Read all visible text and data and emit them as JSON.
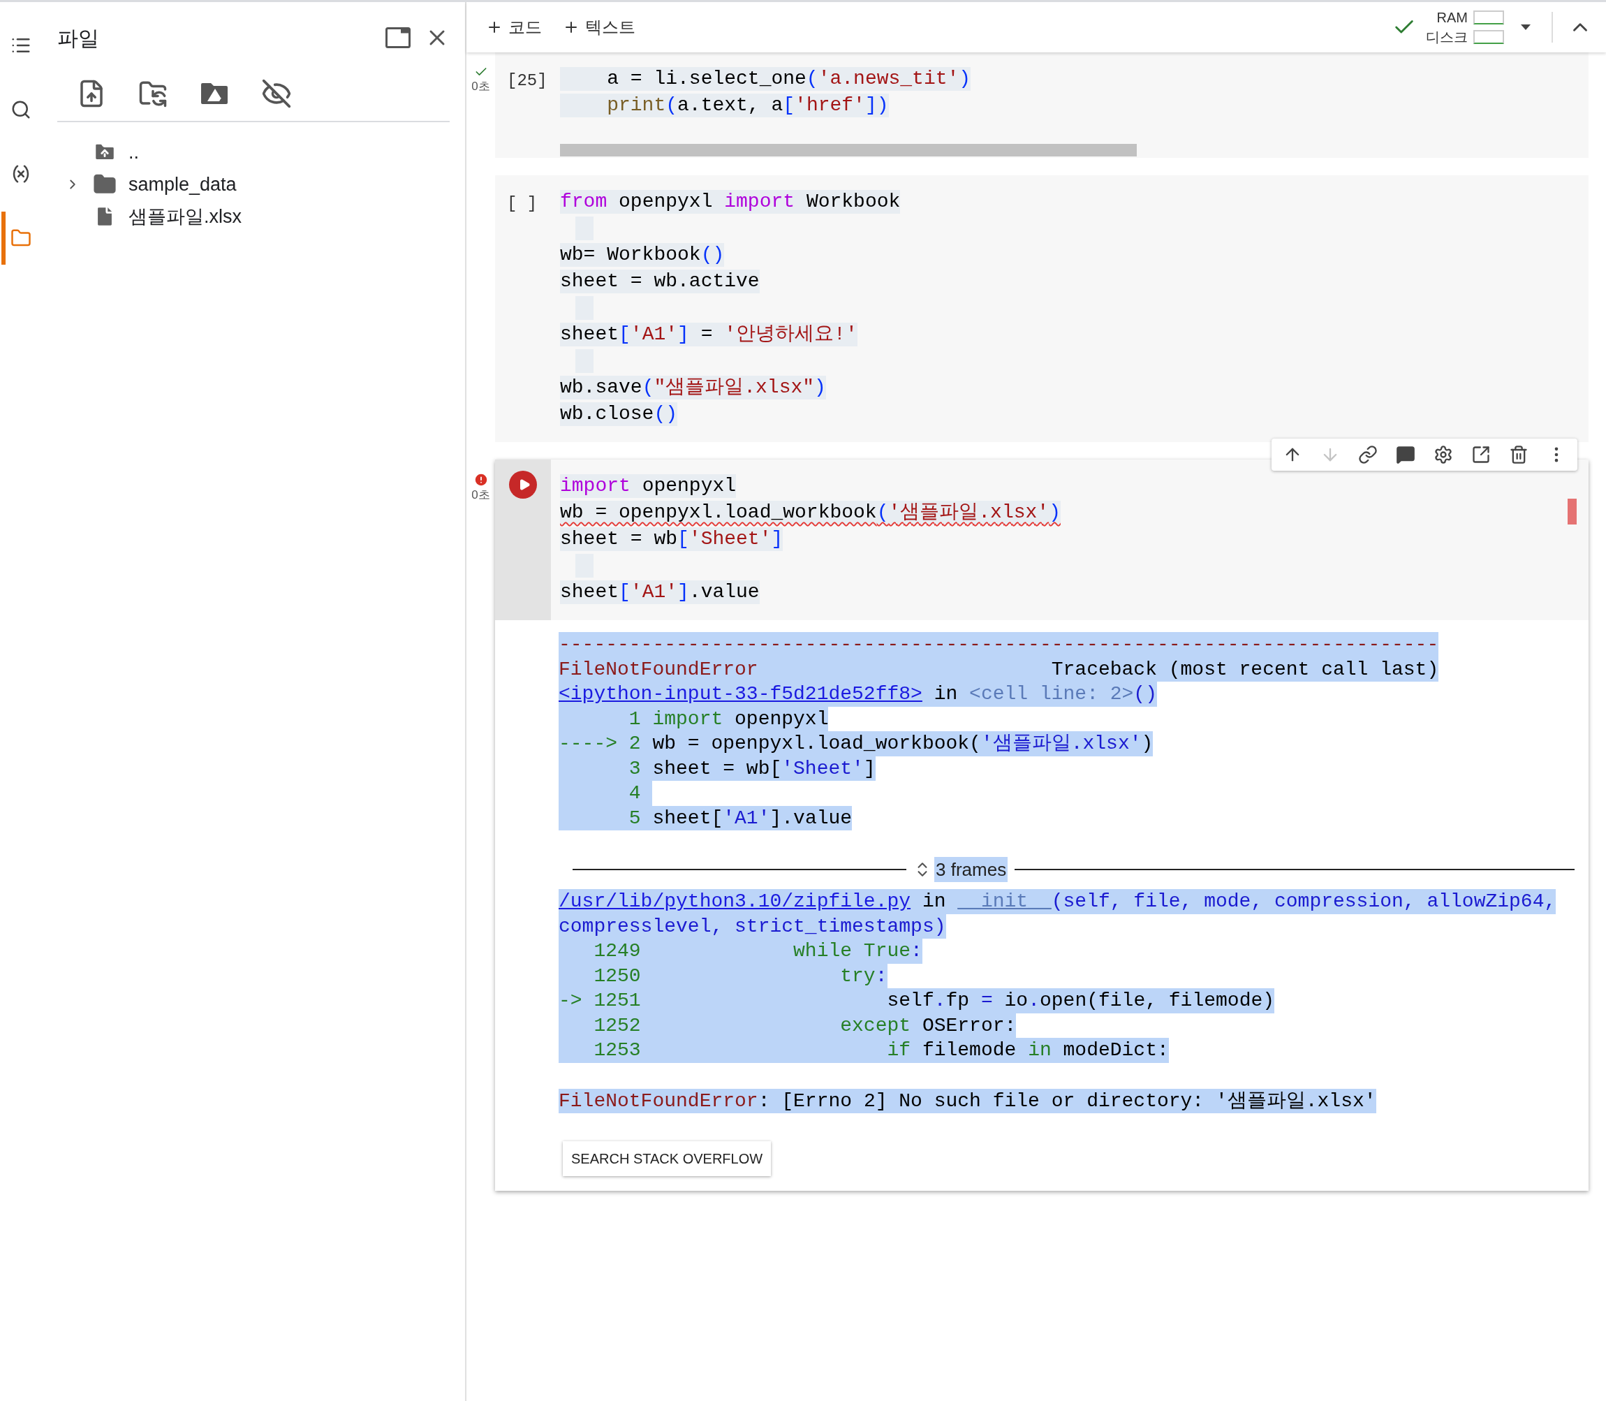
{
  "rail": [
    {
      "kind": "toc",
      "selected": false
    },
    {
      "kind": "search",
      "selected": false
    },
    {
      "kind": "variables",
      "selected": false
    },
    {
      "kind": "files",
      "selected": true
    }
  ],
  "sidebar": {
    "title": "파일",
    "tree": [
      {
        "kind": "parent",
        "name": ".."
      },
      {
        "kind": "folder",
        "name": "sample_data",
        "expanded": false
      },
      {
        "kind": "file",
        "name": "샘플파일.xlsx"
      }
    ]
  },
  "toolbar": {
    "add_buttons": [
      "코드",
      "텍스트"
    ],
    "connected": true,
    "ram_label": "RAM",
    "disk_label": "디스크"
  },
  "cells": [
    {
      "ran_ok": true,
      "time": "0초",
      "label": "[25]",
      "focused": false,
      "h_scrollbar": true,
      "lines": [
        {
          "tokens": [
            {
              "text": "    a = li.select_one",
              "kind": "plain"
            },
            {
              "text": "(",
              "kind": "bracket"
            },
            {
              "text": "'a.news_tit'",
              "kind": "string"
            },
            {
              "text": ")",
              "kind": "bracket"
            }
          ]
        },
        {
          "tokens": [
            {
              "text": "    print",
              "kind": "function"
            },
            {
              "text": "(",
              "kind": "bracket"
            },
            {
              "text": "a.text, a",
              "kind": "plain"
            },
            {
              "text": "[",
              "kind": "bracket"
            },
            {
              "text": "'href'",
              "kind": "string"
            },
            {
              "text": "])",
              "kind": "bracket"
            }
          ]
        }
      ]
    },
    {
      "label": "[ ]",
      "focused": false,
      "lines": [
        {
          "tokens": [
            {
              "text": "from",
              "kind": "keyword"
            },
            {
              "text": " openpyxl ",
              "kind": "plain"
            },
            {
              "text": "import",
              "kind": "keyword"
            },
            {
              "text": " Workbook",
              "kind": "plain"
            }
          ]
        },
        {
          "kind": "blank"
        },
        {
          "tokens": [
            {
              "text": "wb= Workbook",
              "kind": "plain"
            },
            {
              "text": "()",
              "kind": "bracket"
            }
          ]
        },
        {
          "tokens": [
            {
              "text": "sheet = wb.active",
              "kind": "plain"
            }
          ]
        },
        {
          "kind": "blank"
        },
        {
          "tokens": [
            {
              "text": "sheet",
              "kind": "plain"
            },
            {
              "text": "[",
              "kind": "bracket"
            },
            {
              "text": "'A1'",
              "kind": "string"
            },
            {
              "text": "]",
              "kind": "bracket"
            },
            {
              "text": " = ",
              "kind": "plain"
            },
            {
              "text": "'안녕하세요!'",
              "kind": "string"
            }
          ]
        },
        {
          "kind": "blank"
        },
        {
          "tokens": [
            {
              "text": "wb.save",
              "kind": "plain"
            },
            {
              "text": "(",
              "kind": "bracket"
            },
            {
              "text": "\"샘플파일.xlsx\"",
              "kind": "string"
            },
            {
              "text": ")",
              "kind": "bracket"
            }
          ]
        },
        {
          "tokens": [
            {
              "text": "wb.close",
              "kind": "plain"
            },
            {
              "text": "()",
              "kind": "bracket"
            }
          ]
        }
      ]
    },
    {
      "has_error": true,
      "time": "0초",
      "focused": true,
      "lines": [
        {
          "tokens": [
            {
              "text": "import",
              "kind": "keyword"
            },
            {
              "text": " openpyxl",
              "kind": "plain"
            }
          ]
        },
        {
          "tokens": [
            {
              "text": "wb = openpyxl.load_workbook",
              "kind": "plain"
            },
            {
              "text": "(",
              "kind": "bracket"
            },
            {
              "text": "'샘플파일.xlsx'",
              "kind": "string"
            },
            {
              "text": ")",
              "kind": "bracket"
            }
          ],
          "error_underline": true
        },
        {
          "tokens": [
            {
              "text": "sheet = wb",
              "kind": "plain"
            },
            {
              "text": "[",
              "kind": "bracket"
            },
            {
              "text": "'Sheet'",
              "kind": "string"
            },
            {
              "text": "]",
              "kind": "bracket"
            }
          ]
        },
        {
          "kind": "blank"
        },
        {
          "tokens": [
            {
              "text": "sheet",
              "kind": "plain"
            },
            {
              "text": "[",
              "kind": "bracket"
            },
            {
              "text": "'A1'",
              "kind": "string"
            },
            {
              "text": "]",
              "kind": "bracket"
            },
            {
              "text": ".value",
              "kind": "plain"
            }
          ]
        }
      ],
      "toolbar": [
        {
          "kind": "up",
          "disabled": false
        },
        {
          "kind": "down",
          "disabled": true
        },
        {
          "kind": "link",
          "disabled": false
        },
        {
          "kind": "comment",
          "disabled": false
        },
        {
          "kind": "settings",
          "disabled": false
        },
        {
          "kind": "mirror",
          "disabled": false
        },
        {
          "kind": "delete",
          "disabled": false
        },
        {
          "kind": "more",
          "disabled": false
        }
      ],
      "output": {
        "traceback": [
          {
            "tokens": [
              {
                "text": "---------------------------------------------------------------------------",
                "kind": "error"
              }
            ]
          },
          {
            "tokens": [
              {
                "text": "FileNotFoundError",
                "kind": "error"
              },
              {
                "text": "                         Traceback (most recent call last)",
                "kind": "plain"
              }
            ]
          },
          {
            "tokens": [
              {
                "text": "<ipython-input-33-f5d21de52ff8>",
                "kind": "link"
              },
              {
                "text": " in ",
                "kind": "plain"
              },
              {
                "text": "<cell line: 2>",
                "kind": "dim"
              },
              {
                "text": "()",
                "kind": "name"
              }
            ]
          },
          {
            "tokens": [
              {
                "text": "      1 import",
                "kind": "green"
              },
              {
                "text": " openpyxl",
                "kind": "plain"
              }
            ]
          },
          {
            "tokens": [
              {
                "text": "----> 2 ",
                "kind": "green"
              },
              {
                "text": "wb = openpyxl.load_workbook(",
                "kind": "plain"
              },
              {
                "text": "'샘플파일.xlsx'",
                "kind": "name"
              },
              {
                "text": ")",
                "kind": "plain"
              }
            ]
          },
          {
            "tokens": [
              {
                "text": "      3 ",
                "kind": "green"
              },
              {
                "text": "sheet = wb[",
                "kind": "plain"
              },
              {
                "text": "'Sheet'",
                "kind": "name"
              },
              {
                "text": "]",
                "kind": "plain"
              }
            ]
          },
          {
            "tokens": [
              {
                "text": "      4 ",
                "kind": "green"
              }
            ]
          },
          {
            "tokens": [
              {
                "text": "      5 ",
                "kind": "green"
              },
              {
                "text": "sheet[",
                "kind": "plain"
              },
              {
                "text": "'A1'",
                "kind": "name"
              },
              {
                "text": "].value",
                "kind": "plain"
              }
            ]
          }
        ],
        "frames": {
          "label": "3 frames",
          "expanded": false
        },
        "frame_lines": [
          {
            "tokens": [
              {
                "text": "/usr/lib/python3.10/zipfile.py",
                "kind": "link"
              },
              {
                "text": " in ",
                "kind": "plain"
              },
              {
                "text": "__init__",
                "kind": "dim_underlined"
              },
              {
                "text": "(self, file, mode, compression, allowZip64,",
                "kind": "name"
              }
            ]
          },
          {
            "tokens": [
              {
                "text": "compresslevel, strict_timestamps)",
                "kind": "name"
              }
            ]
          },
          {
            "tokens": [
              {
                "text": "   1249             while True",
                "kind": "green"
              },
              {
                "text": ":",
                "kind": "name"
              }
            ]
          },
          {
            "tokens": [
              {
                "text": "   1250                 try",
                "kind": "green"
              },
              {
                "text": ":",
                "kind": "name"
              }
            ]
          },
          {
            "tokens": [
              {
                "text": "-> 1251",
                "kind": "green"
              },
              {
                "text": "                     self",
                "kind": "plain"
              },
              {
                "text": ".",
                "kind": "name"
              },
              {
                "text": "fp ",
                "kind": "plain"
              },
              {
                "text": "=",
                "kind": "name"
              },
              {
                "text": " io",
                "kind": "plain"
              },
              {
                "text": ".",
                "kind": "name"
              },
              {
                "text": "open(file, filemode)",
                "kind": "plain"
              }
            ]
          },
          {
            "tokens": [
              {
                "text": "   1252                 except",
                "kind": "green"
              },
              {
                "text": " OSError:",
                "kind": "plain"
              }
            ]
          },
          {
            "tokens": [
              {
                "text": "   1253                     if",
                "kind": "green"
              },
              {
                "text": " filemode ",
                "kind": "plain"
              },
              {
                "text": "in",
                "kind": "green"
              },
              {
                "text": " modeDict:",
                "kind": "plain"
              }
            ]
          }
        ],
        "error_line": {
          "tokens": [
            {
              "text": "FileNotFoundError",
              "kind": "error"
            },
            {
              "text": ": [Errno 2] No such file or directory: '샘플파일.xlsx'",
              "kind": "plain"
            }
          ]
        },
        "button": "SEARCH STACK OVERFLOW"
      }
    }
  ]
}
